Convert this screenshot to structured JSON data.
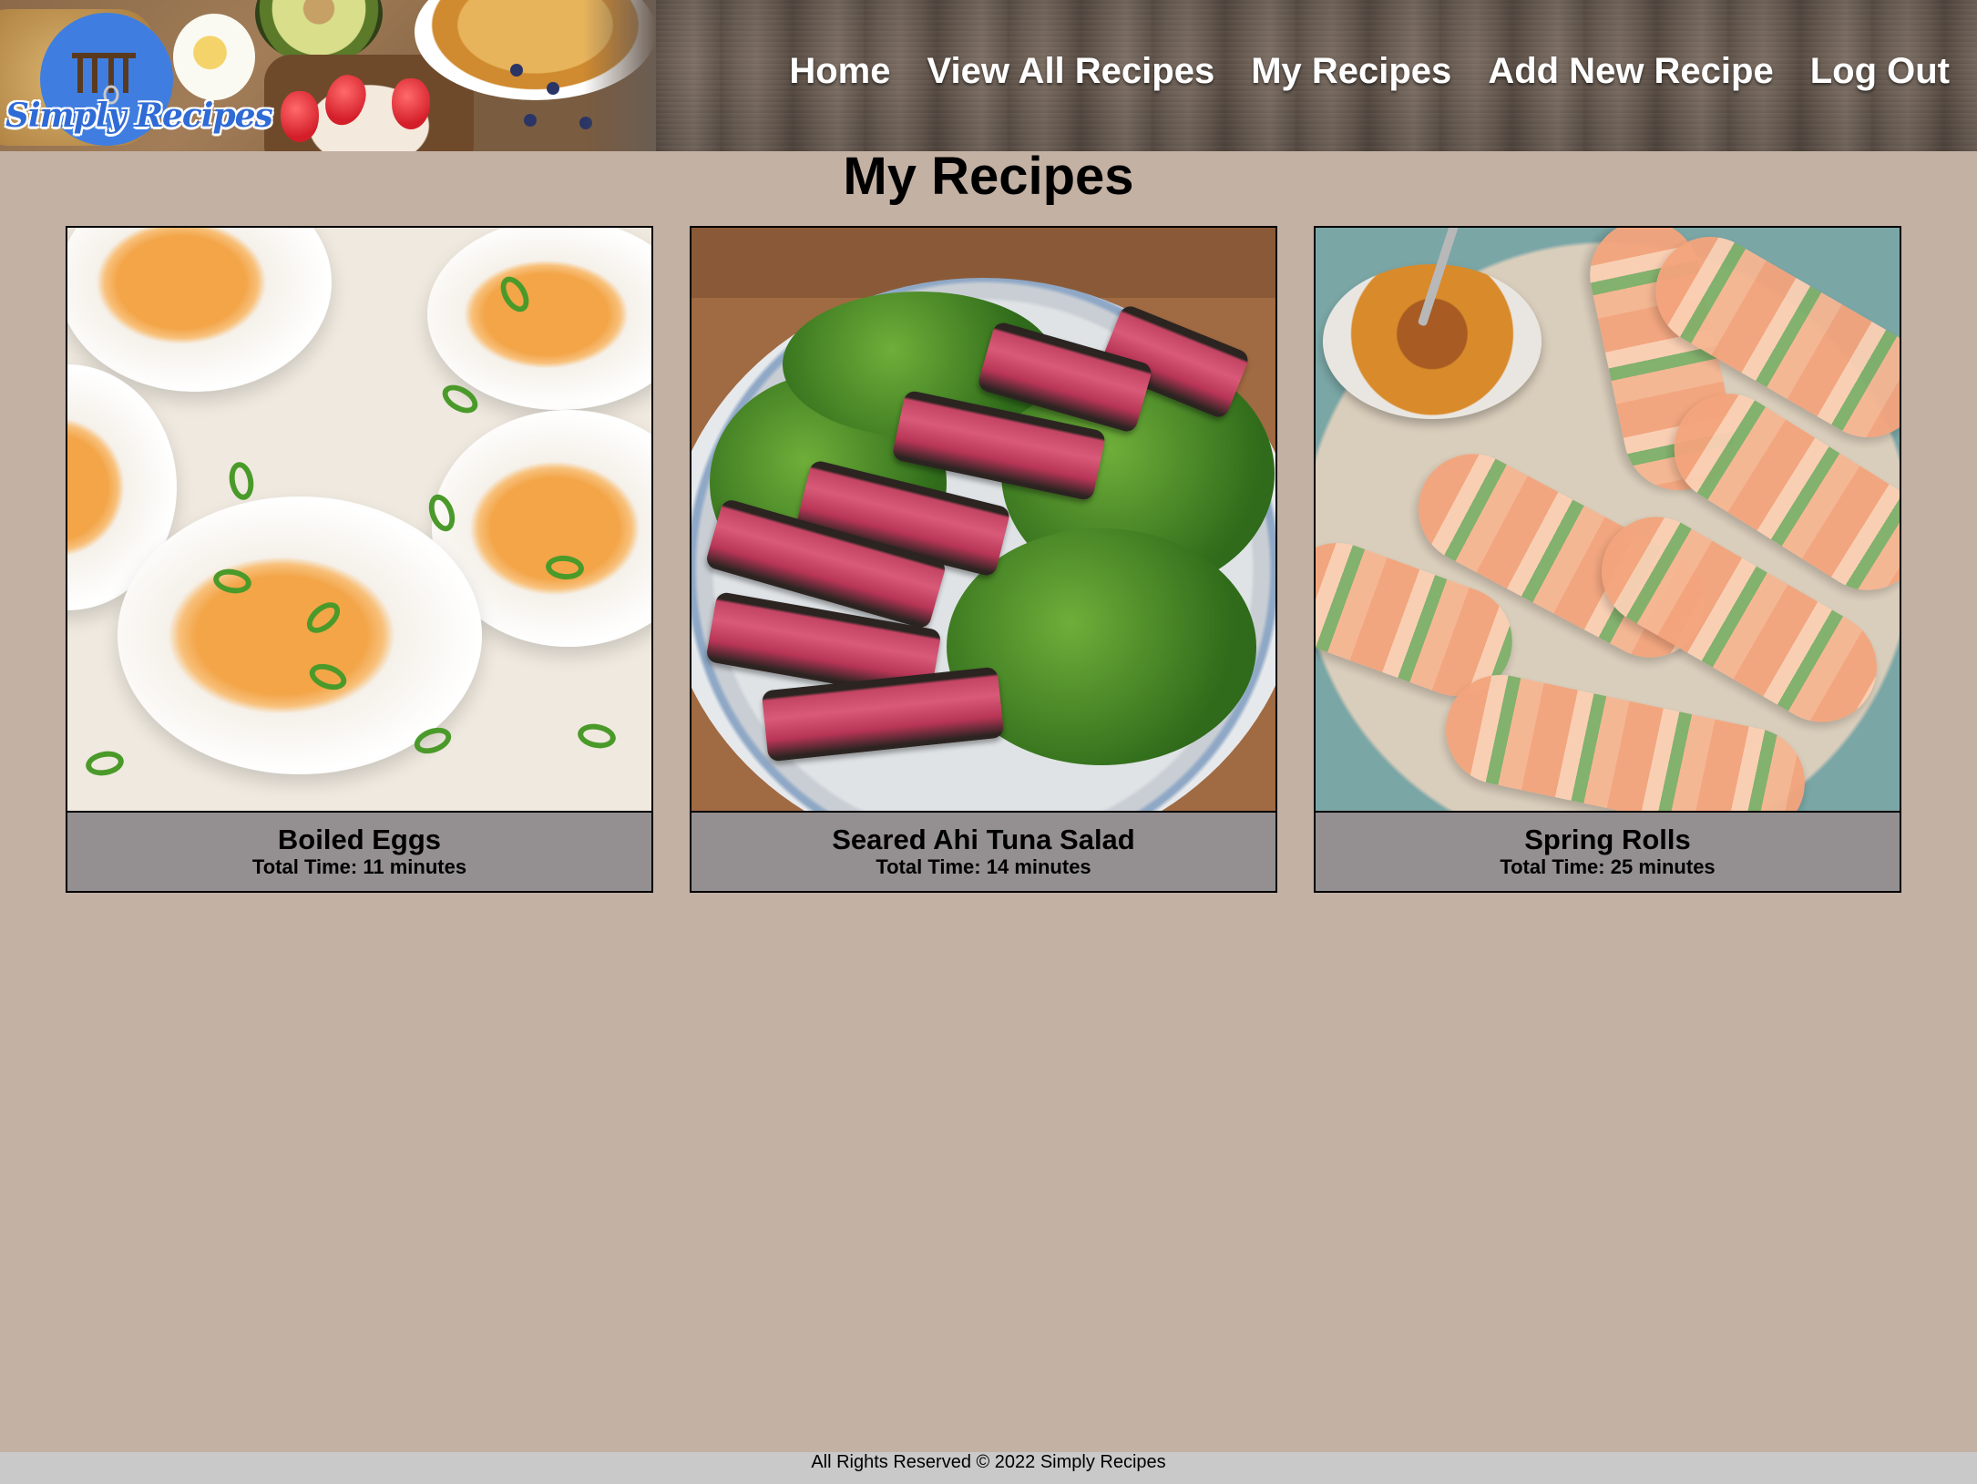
{
  "brand": {
    "logo_text": "Simply Recipes"
  },
  "nav": {
    "items": [
      {
        "label": "Home"
      },
      {
        "label": "View All Recipes"
      },
      {
        "label": "My Recipes"
      },
      {
        "label": "Add New Recipe"
      },
      {
        "label": "Log Out"
      }
    ]
  },
  "main": {
    "title": "My Recipes",
    "recipes": [
      {
        "name": "Boiled Eggs",
        "time": "Total Time: 11 minutes"
      },
      {
        "name": "Seared Ahi Tuna Salad",
        "time": "Total Time: 14 minutes"
      },
      {
        "name": "Spring Rolls",
        "time": "Total Time: 25 minutes"
      }
    ]
  },
  "footer": {
    "text": "All Rights Reserved © 2022 Simply Recipes"
  },
  "colors": {
    "page_background": "#c3b1a4",
    "card_caption": "#949091",
    "footer_background": "#c9c9c9",
    "logo_blue": "#3f7ee0"
  }
}
